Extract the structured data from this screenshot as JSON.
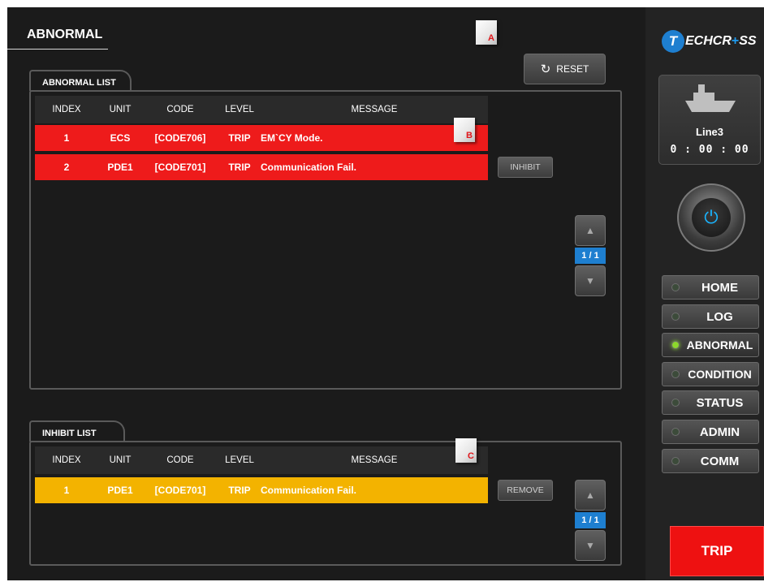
{
  "page": {
    "title": "ABNORMAL"
  },
  "markers": {
    "a": "A",
    "b": "B",
    "c": "C"
  },
  "reset": {
    "label": "RESET",
    "icon": "refresh-icon"
  },
  "abnormal_list": {
    "tab_label": "ABNORMAL LIST",
    "columns": {
      "index": "INDEX",
      "unit": "UNIT",
      "code": "CODE",
      "level": "LEVEL",
      "message": "MESSAGE"
    },
    "rows": [
      {
        "index": "1",
        "unit": "ECS",
        "code": "[CODE706]",
        "level": "TRIP",
        "message": "EM`CY Mode."
      },
      {
        "index": "2",
        "unit": "PDE1",
        "code": "[CODE701]",
        "level": "TRIP",
        "message": "Communication Fail."
      }
    ],
    "action_label": "INHIBIT",
    "pager": {
      "up_icon": "▲",
      "label": "1 / 1",
      "down_icon": "▼"
    }
  },
  "inhibit_list": {
    "tab_label": "INHIBIT LIST",
    "columns": {
      "index": "INDEX",
      "unit": "UNIT",
      "code": "CODE",
      "level": "LEVEL",
      "message": "MESSAGE"
    },
    "rows": [
      {
        "index": "1",
        "unit": "PDE1",
        "code": "[CODE701]",
        "level": "TRIP",
        "message": "Communication Fail."
      }
    ],
    "action_label": "REMOVE",
    "pager": {
      "up_icon": "▲",
      "label": "1 / 1",
      "down_icon": "▼"
    }
  },
  "sidebar": {
    "logo": {
      "t": "T",
      "part1": "ECHCR",
      "plus": "+",
      "part2": "SS"
    },
    "line": {
      "name": "Line3",
      "time": "0 : 00 : 00"
    },
    "power_icon": "⏻",
    "nav": [
      {
        "label": "HOME",
        "active": false
      },
      {
        "label": "LOG",
        "active": false
      },
      {
        "label": "ABNORMAL",
        "active": true
      },
      {
        "label": "CONDITION",
        "active": false
      },
      {
        "label": "STATUS",
        "active": false
      },
      {
        "label": "ADMIN",
        "active": false
      },
      {
        "label": "COMM",
        "active": false
      }
    ],
    "trip_label": "TRIP"
  },
  "colors": {
    "alarm_row": "#ee1b1b",
    "inhibit_row": "#f3b300",
    "accent": "#1e7fd0",
    "active_led": "#8cd92b"
  }
}
